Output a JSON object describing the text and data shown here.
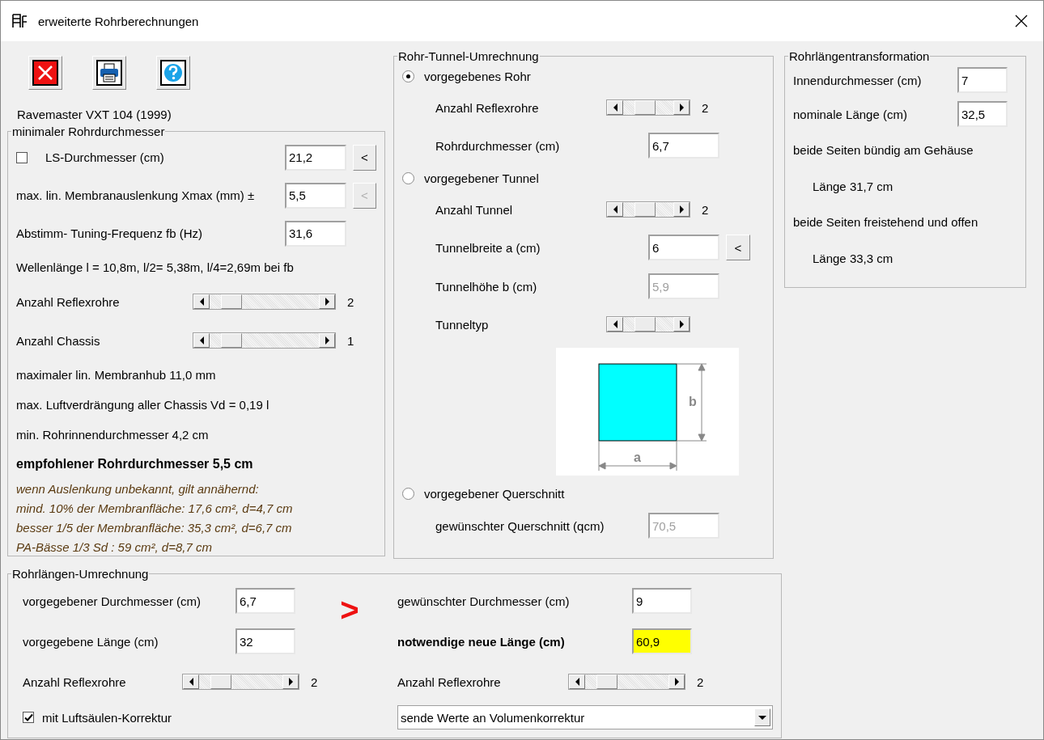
{
  "window": {
    "title": "erweiterte Rohrberechnungen"
  },
  "toolbar": [
    {
      "kind": "close"
    },
    {
      "kind": "print"
    },
    {
      "kind": "help"
    }
  ],
  "model": "Ravemaster VXT 104 (1999)",
  "min_group": {
    "title": "minimaler Rohrdurchmesser",
    "rows": [
      {
        "kind": "field",
        "checkbox": {
          "checked": false
        },
        "label": "LS-Durchmesser (cm)",
        "value": "21,2",
        "disabled": false,
        "button": {
          "label": "<",
          "disabled": false
        }
      },
      {
        "kind": "field",
        "label": "max. lin. Membranauslenkung Xmax (mm) ±",
        "value": "5,5",
        "disabled": false,
        "button": {
          "label": "<",
          "disabled": true
        }
      },
      {
        "kind": "field",
        "label": "Abstimm- Tuning-Frequenz fb (Hz)",
        "value": "31,6",
        "disabled": false
      },
      {
        "kind": "text",
        "label": "Wellenlänge l = 10,8m, l/2= 5,38m, l/4=2,69m bei fb"
      },
      {
        "kind": "scroll",
        "label": "Anzahl Reflexrohre",
        "reading": "2"
      },
      {
        "kind": "scroll",
        "label": "Anzahl Chassis",
        "reading": "1"
      },
      {
        "kind": "text",
        "label": "maximaler lin. Membranhub 11,0 mm"
      },
      {
        "kind": "text",
        "label": "max. Luftverdrängung aller Chassis Vd = 0,19 l"
      },
      {
        "kind": "text",
        "label": "min. Rohrinnendurchmesser 4,2 cm"
      },
      {
        "kind": "bold",
        "label": "empfohlener Rohrdurchmesser 5,5 cm"
      },
      {
        "kind": "note",
        "label": "wenn Auslenkung unbekannt, gilt annähernd:"
      },
      {
        "kind": "note",
        "label": "mind. 10% der Membranfläche: 17,6 cm², d=4,7 cm"
      },
      {
        "kind": "note",
        "label": "besser 1/5 der Membranfläche: 35,3 cm², d=6,7 cm"
      },
      {
        "kind": "note",
        "label": "PA-Bässe 1/3 Sd : 59 cm², d=8,7 cm"
      }
    ]
  },
  "tunnel_group": {
    "title": "Rohr-Tunnel-Umrechnung",
    "rows": [
      {
        "kind": "radio",
        "label": "vorgegebenes Rohr",
        "selected": true
      },
      {
        "kind": "scroll",
        "label": "Anzahl Reflexrohre",
        "reading": "2"
      },
      {
        "kind": "field",
        "label": "Rohrdurchmesser (cm)",
        "value": "6,7",
        "disabled": false
      },
      {
        "kind": "radio",
        "label": "vorgegebener Tunnel",
        "selected": false
      },
      {
        "kind": "scroll",
        "label": "Anzahl Tunnel",
        "reading": "2"
      },
      {
        "kind": "field",
        "label": "Tunnelbreite a (cm)",
        "value": "6",
        "disabled": false,
        "button": {
          "label": "<",
          "disabled": false
        }
      },
      {
        "kind": "field",
        "label": "Tunnelhöhe b (cm)",
        "value": "5,9",
        "disabled": true
      },
      {
        "kind": "scroll",
        "label": "Tunneltyp"
      },
      {
        "kind": "diagram",
        "width_label": "a",
        "height_label": "b"
      },
      {
        "kind": "radio",
        "label": "vorgegebener Querschnitt",
        "selected": false
      },
      {
        "kind": "field",
        "label": "gewünschter Querschnitt (qcm)",
        "value": "70,5",
        "disabled": true
      }
    ]
  },
  "transform_group": {
    "title": "Rohrlängentransformation",
    "rows": [
      {
        "kind": "field",
        "label": "Innendurchmesser (cm)",
        "value": "7",
        "disabled": false
      },
      {
        "kind": "field",
        "label": "nominale Länge (cm)",
        "value": "32,5",
        "disabled": false
      },
      {
        "kind": "text",
        "label": "beide Seiten bündig am Gehäuse"
      },
      {
        "kind": "result",
        "label": "Länge 31,7 cm"
      },
      {
        "kind": "text",
        "label": "beide Seiten freistehend und offen"
      },
      {
        "kind": "result",
        "label": "Länge 33,3 cm"
      }
    ]
  },
  "length_group": {
    "title": "Rohrlängen-Umrechnung",
    "arrow": ">",
    "left": [
      {
        "kind": "field",
        "label": "vorgegebener Durchmesser (cm)",
        "value": "6,7",
        "disabled": false
      },
      {
        "kind": "field",
        "label": "vorgegebene Länge (cm)",
        "value": "32",
        "disabled": false
      },
      {
        "kind": "scroll",
        "label": "Anzahl Reflexrohre",
        "reading": "2"
      },
      {
        "kind": "check",
        "label": "mit Luftsäulen-Korrektur",
        "checked": true
      }
    ],
    "right": [
      {
        "kind": "field",
        "label": "gewünschter Durchmesser (cm)",
        "value": "9",
        "disabled": false
      },
      {
        "kind": "field",
        "label": "notwendige neue Länge (cm)",
        "value": "60,9",
        "disabled": false,
        "highlight": true,
        "bold": true
      },
      {
        "kind": "scroll",
        "label": "Anzahl Reflexrohre",
        "reading": "2"
      },
      {
        "kind": "dropdown",
        "value": "sende Werte an Volumenkorrektur"
      }
    ]
  }
}
